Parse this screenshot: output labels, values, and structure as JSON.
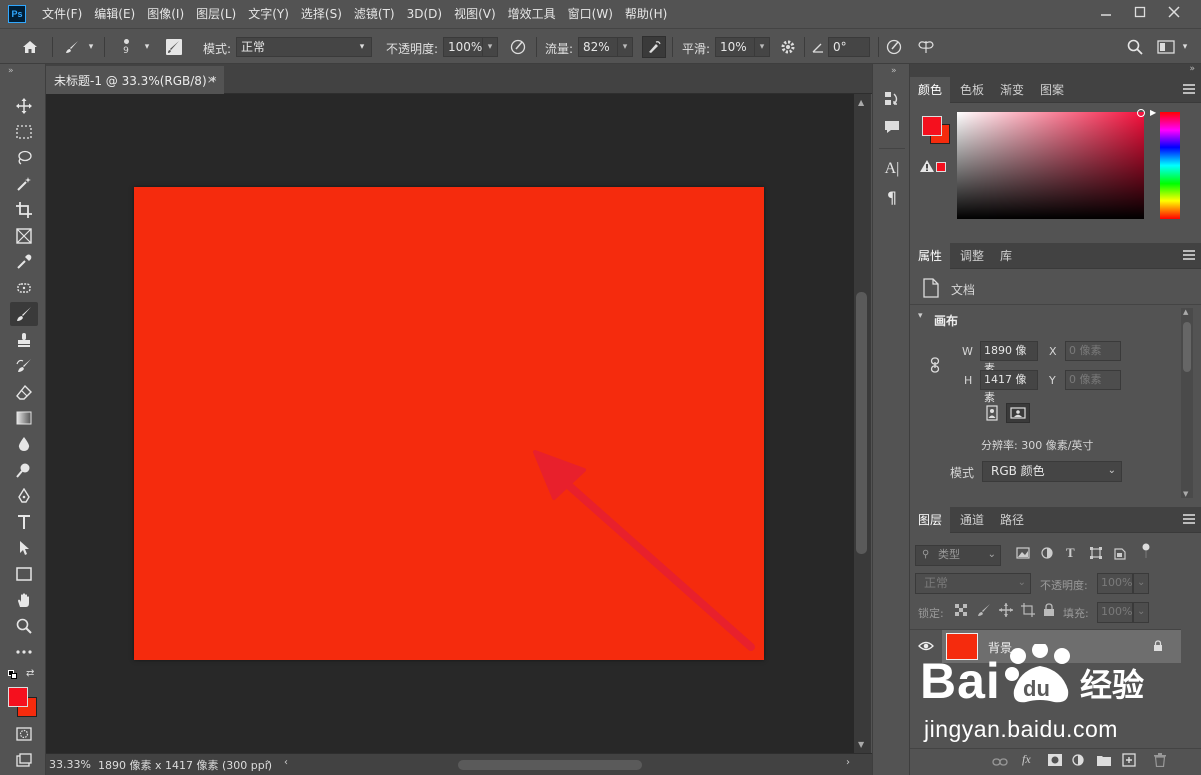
{
  "app": {
    "logo": "Ps",
    "menu": [
      "文件(F)",
      "编辑(E)",
      "图像(I)",
      "图层(L)",
      "文字(Y)",
      "选择(S)",
      "滤镜(T)",
      "3D(D)",
      "视图(V)",
      "增效工具",
      "窗口(W)",
      "帮助(H)"
    ],
    "window_buttons": [
      "minimize-icon",
      "maximize-icon",
      "close-icon"
    ]
  },
  "options": {
    "brush_size": "9",
    "mode_label": "模式:",
    "mode_value": "正常",
    "opacity_label": "不透明度:",
    "opacity_value": "100%",
    "flow_label": "流量:",
    "flow_value": "82%",
    "smooth_label": "平滑:",
    "smooth_value": "10%",
    "angle_value": "0°"
  },
  "document": {
    "tab_title": "未标题-1 @ 33.3%(RGB/8) *",
    "canvas_color": "#f52b0d",
    "zoom": "33.33%",
    "info": "1890 像素 x 1417 像素 (300 ppi)"
  },
  "color_panel": {
    "tabs": [
      "颜色",
      "色板",
      "渐变",
      "图案"
    ],
    "foreground": "#f5101e",
    "background": "#f52b0d"
  },
  "properties": {
    "tabs": [
      "属性",
      "调整",
      "库"
    ],
    "doc_label": "文档",
    "section": "画布",
    "w_label": "W",
    "w_value": "1890 像素",
    "h_label": "H",
    "h_value": "1417 像素",
    "x_label": "X",
    "x_value": "0 像素",
    "y_label": "Y",
    "y_value": "0 像素",
    "resolution": "分辨率: 300 像素/英寸",
    "mode_label": "模式",
    "mode_value": "RGB 颜色"
  },
  "layers": {
    "tabs": [
      "图层",
      "通道",
      "路径"
    ],
    "filter_placeholder": "类型",
    "blend_mode": "正常",
    "opacity_label": "不透明度:",
    "opacity_value": "100%",
    "lock_label": "锁定:",
    "fill_label": "填充:",
    "fill_value": "100%",
    "layer_name": "背景",
    "layer_color": "#f52b0d"
  },
  "watermark": {
    "brand": "Bai",
    "brand2": "du",
    "cn": "经验",
    "url": "jingyan.baidu.com"
  }
}
